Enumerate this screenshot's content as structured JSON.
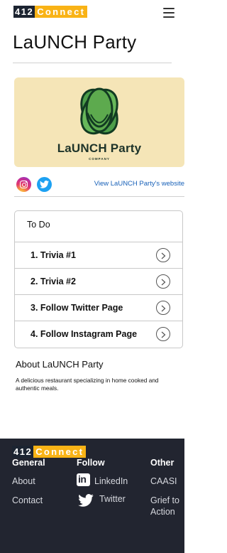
{
  "header": {
    "logo_num": "412",
    "logo_word": "Connect",
    "menu_icon": "hamburger-menu-icon"
  },
  "page": {
    "title": "LaUNCH Party"
  },
  "hero": {
    "brand_name": "LaUNCH Party",
    "brand_sub": "COMPANY",
    "bg_color": "#f5e5b7",
    "accent_color": "#4c9e49"
  },
  "social": {
    "instagram_icon": "instagram-icon",
    "twitter_icon": "twitter-icon",
    "website_link": "View LaUNCH Party's website"
  },
  "todo": {
    "heading": "To Do",
    "items": [
      {
        "label": "1. Trivia #1"
      },
      {
        "label": "2. Trivia #2"
      },
      {
        "label": "3. Follow Twitter Page"
      },
      {
        "label": "4. Follow Instagram Page"
      }
    ]
  },
  "about": {
    "title": "About LaUNCH Party",
    "text": "A delicious restaurant specializing in home cooked and authentic meals."
  },
  "footer": {
    "logo_num": "412",
    "logo_word": "Connect",
    "columns": [
      {
        "title": "General",
        "links": [
          "About",
          "Contact"
        ]
      },
      {
        "title": "Follow",
        "links": [
          "LinkedIn",
          "Twitter"
        ]
      },
      {
        "title": "Other",
        "links": [
          "CAASI",
          "Grief to",
          "Action"
        ]
      }
    ],
    "bg_color": "#222530"
  }
}
